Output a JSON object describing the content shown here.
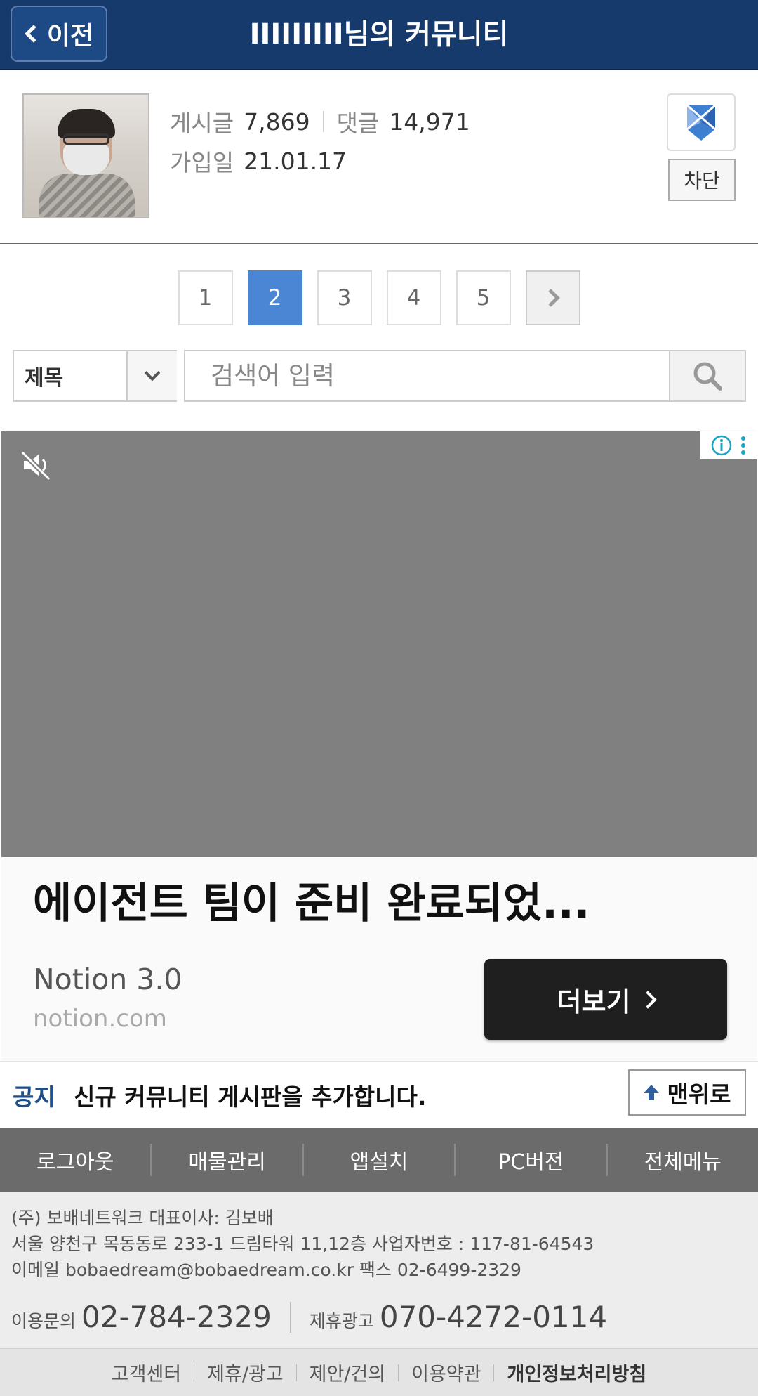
{
  "header": {
    "back_label": "이전",
    "title": "IIIIIIIII님의 커뮤니티"
  },
  "profile": {
    "posts_label": "게시글",
    "posts_value": "7,869",
    "comments_label": "댓글",
    "comments_value": "14,971",
    "joined_label": "가입일",
    "joined_value": "21.01.17",
    "block_label": "차단"
  },
  "pagination": {
    "pages": [
      "1",
      "2",
      "3",
      "4",
      "5"
    ],
    "current": "2"
  },
  "search": {
    "field_option": "제목",
    "placeholder": "검색어 입력"
  },
  "ad": {
    "headline": "에이전트 팀이 준비 완료되었...",
    "brand": "Notion 3.0",
    "domain": "notion.com",
    "cta_label": "더보기"
  },
  "notice": {
    "tag": "공지",
    "text": "신규 커뮤니티 게시판을 추가합니다.",
    "top_label": "맨위로"
  },
  "footer_nav": [
    "로그아웃",
    "매물관리",
    "앱설치",
    "PC버전",
    "전체메뉴"
  ],
  "footer_info": {
    "line1": "(주) 보배네트워크 대표이사: 김보배",
    "line2": "서울 양천구 목동동로 233-1 드림타워 11,12층 사업자번호 : 117-81-64543",
    "line3": "이메일 bobaedream@bobaedream.co.kr      팩스 02-6499-2329",
    "inquiry_label": "이용문의",
    "inquiry_phone": "02-784-2329",
    "ad_label": "제휴광고",
    "ad_phone": "070-4272-0114"
  },
  "footer_links": [
    "고객센터",
    "제휴/광고",
    "제안/건의",
    "이용약관",
    "개인정보처리방침"
  ],
  "colors": {
    "header_bg": "#163a6b",
    "active_page": "#4a86d4",
    "notice_tag": "#1f4f8a",
    "footer_nav_bg": "#6b6b6b"
  }
}
